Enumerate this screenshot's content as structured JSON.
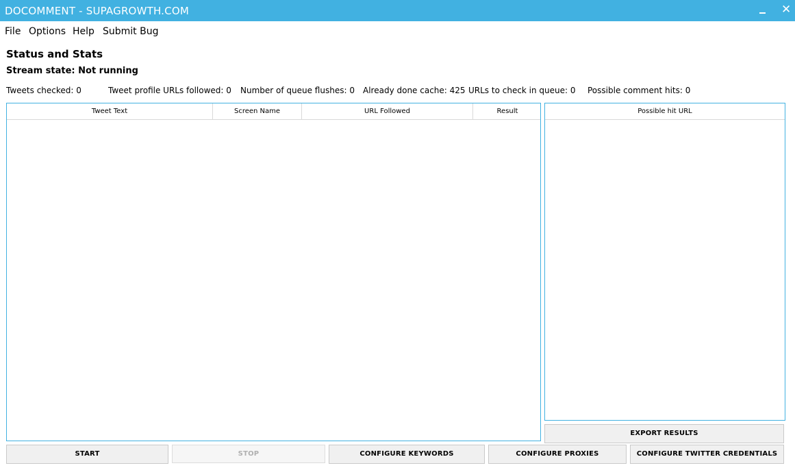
{
  "window": {
    "title": "DOCOMMENT - SUPAGROWTH.COM"
  },
  "menu": {
    "file": "File",
    "options": "Options",
    "help": "Help",
    "submit_bug": "Submit Bug"
  },
  "status": {
    "heading": "Status and Stats",
    "stream_state": "Stream state: Not running",
    "stats": {
      "tweets_checked": "Tweets checked: 0",
      "profile_urls": "Tweet profile URLs followed: 0",
      "queue_flushes": "Number of queue flushes: 0",
      "done_cache": "Already done cache: 425",
      "urls_in_queue": "URLs to check in queue: 0",
      "comment_hits": "Possible comment hits: 0"
    }
  },
  "main_table": {
    "columns": [
      "Tweet Text",
      "Screen Name",
      "URL Followed",
      "Result"
    ],
    "rows": []
  },
  "hits_table": {
    "columns": [
      "Possible hit URL"
    ],
    "rows": []
  },
  "buttons": {
    "export": "EXPORT RESULTS",
    "start": "START",
    "stop": "STOP",
    "keywords": "CONFIGURE KEYWORDS",
    "proxies": "CONFIGURE PROXIES",
    "twitter": "CONFIGURE TWITTER CREDENTIALS"
  },
  "colors": {
    "accent": "#41b1e1"
  }
}
